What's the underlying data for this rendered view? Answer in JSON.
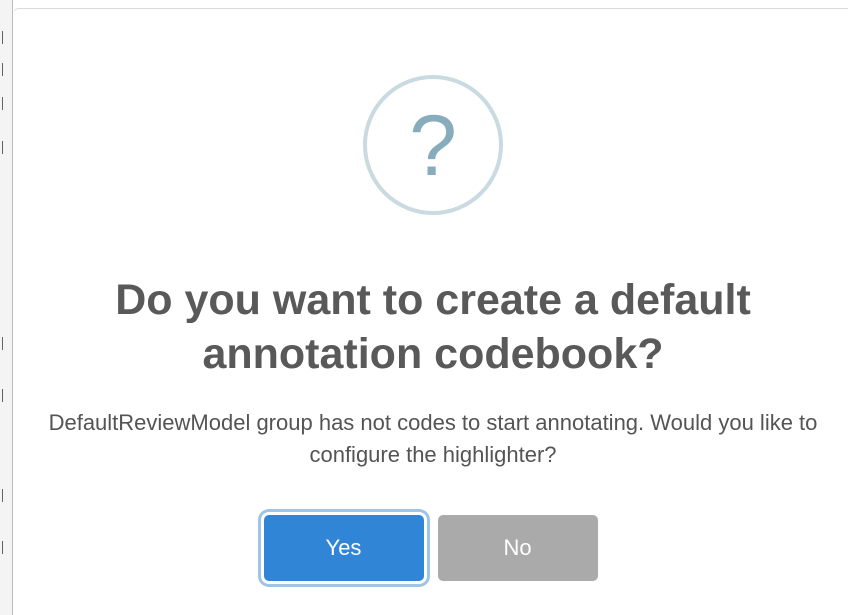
{
  "dialog": {
    "icon": "question-icon",
    "icon_glyph": "?",
    "title": "Do you want to create a default annotation codebook?",
    "message": "DefaultReviewModel group has not codes to start annotating. Would you like to configure the highlighter?",
    "confirm_label": "Yes",
    "cancel_label": "No"
  },
  "colors": {
    "confirm_button": "#3085d6",
    "cancel_button": "#aaaaaa",
    "icon_ring": "#c9dae1",
    "icon_glyph": "#87adbd",
    "title_text": "#595959",
    "message_text": "#545454"
  }
}
